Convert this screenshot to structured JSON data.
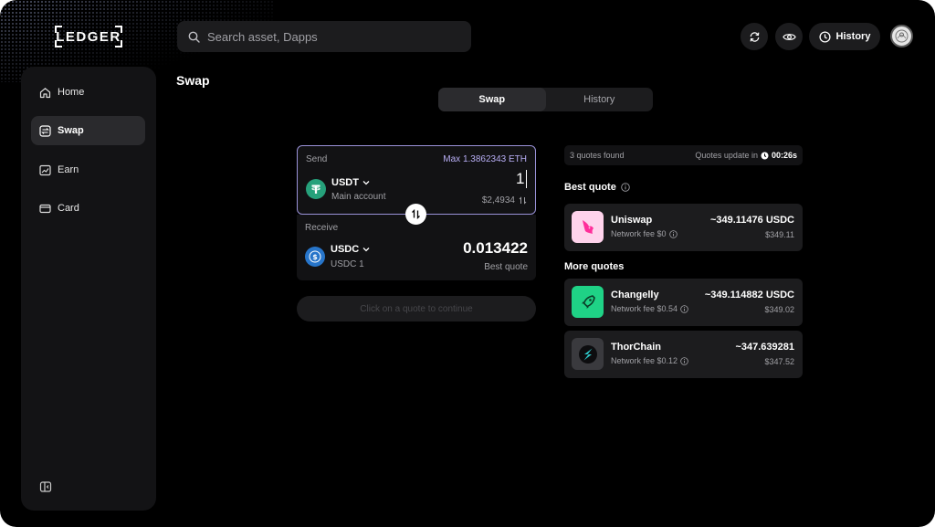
{
  "app": {
    "logo": "LEDGER"
  },
  "search": {
    "placeholder": "Search asset, Dapps"
  },
  "header": {
    "history_label": "History"
  },
  "sidebar": {
    "items": [
      {
        "label": "Home",
        "icon": "home-icon"
      },
      {
        "label": "Swap",
        "icon": "swap-icon",
        "active": true
      },
      {
        "label": "Earn",
        "icon": "chart-icon"
      },
      {
        "label": "Card",
        "icon": "card-icon"
      }
    ]
  },
  "page": {
    "title": "Swap"
  },
  "tabs": [
    {
      "label": "Swap",
      "active": true
    },
    {
      "label": "History",
      "active": false
    }
  ],
  "send": {
    "label": "Send",
    "max": "Max 1.3862343 ETH",
    "token": "USDT",
    "account": "Main account",
    "amount": "1",
    "fiat": "$2,4934"
  },
  "receive": {
    "label": "Receive",
    "token": "USDC",
    "account": "USDC 1",
    "amount": "0.013422",
    "note": "Best quote"
  },
  "cta": {
    "label": "Click on a quote to continue"
  },
  "quotes": {
    "found": "3 quotes found",
    "update_prefix": "Quotes update in",
    "timer": "00:26s",
    "best_title": "Best quote",
    "more_title": "More quotes",
    "best": {
      "name": "Uniswap",
      "fee": "Network fee $0",
      "amount": "~349.11476 USDC",
      "fiat": "$349.11"
    },
    "more": [
      {
        "name": "Changelly",
        "fee": "Network fee $0.54",
        "amount": "~349.114882 USDC",
        "fiat": "$349.02"
      },
      {
        "name": "ThorChain",
        "fee": "Network fee $0.12",
        "amount": "~347.639281",
        "fiat": "$347.52"
      }
    ]
  },
  "colors": {
    "accent": "#b8aef5",
    "usdt": "#26a17b",
    "usdc": "#2775ca",
    "uniswap_bg": "#ffd3ec",
    "changelly_bg": "#1fd286",
    "thorchain_bg": "#3a3a3e"
  }
}
